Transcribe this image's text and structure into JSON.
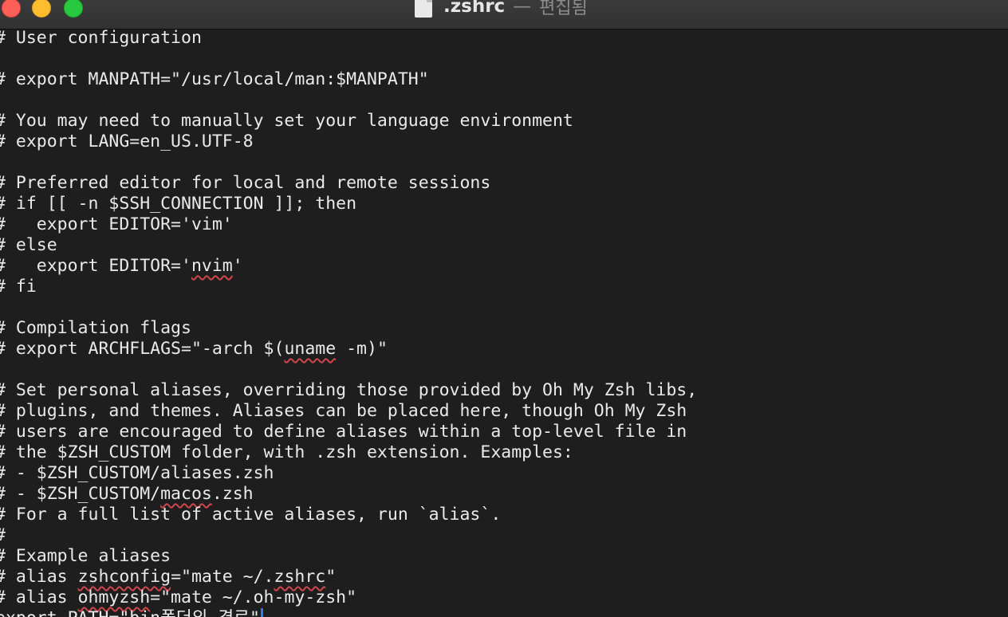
{
  "window": {
    "filename": ".zshrc",
    "separator": "—",
    "status": "편집됨"
  },
  "editor": {
    "lines": [
      "# User configuration",
      "",
      "# export MANPATH=\"/usr/local/man:$MANPATH\"",
      "",
      "# You may need to manually set your language environment",
      "# export LANG=en_US.UTF-8",
      "",
      "# Preferred editor for local and remote sessions",
      "# if [[ -n $SSH_CONNECTION ]]; then",
      "#   export EDITOR='vim'",
      "# else",
      "#   export EDITOR='nvim'",
      "# fi",
      "",
      "# Compilation flags",
      "# export ARCHFLAGS=\"-arch $(uname -m)\"",
      "",
      "# Set personal aliases, overriding those provided by Oh My Zsh libs,",
      "# plugins, and themes. Aliases can be placed here, though Oh My Zsh",
      "# users are encouraged to define aliases within a top-level file in",
      "# the $ZSH_CUSTOM folder, with .zsh extension. Examples:",
      "# - $ZSH_CUSTOM/aliases.zsh",
      "# - $ZSH_CUSTOM/macos.zsh",
      "# For a full list of active aliases, run `alias`.",
      "#",
      "# Example aliases",
      "# alias zshconfig=\"mate ~/.zshrc\"",
      "# alias ohmyzsh=\"mate ~/.oh-my-zsh\"",
      "export PATH=\"bin폴더의 경로\""
    ],
    "misspelled_words": [
      "nvim",
      "uname",
      "macos",
      "zshconfig",
      "zshrc",
      "ohmyzsh"
    ],
    "cursor_line_index": 28,
    "spellcheck_underline_color": "#d0454c",
    "caret_color": "#2f7cf6"
  }
}
